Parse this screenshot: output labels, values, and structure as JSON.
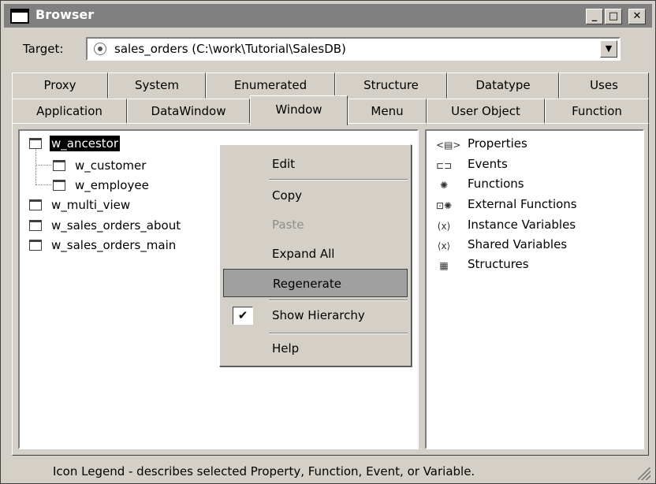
{
  "window": {
    "title": "Browser"
  },
  "target": {
    "label": "Target:",
    "value": "sales_orders (C:\\work\\Tutorial\\SalesDB)"
  },
  "tabs": {
    "row1": [
      "Proxy",
      "System",
      "Enumerated",
      "Structure",
      "Datatype",
      "Uses"
    ],
    "row2": [
      "Application",
      "DataWindow",
      "Window",
      "Menu",
      "User Object",
      "Function"
    ],
    "active": "Window"
  },
  "tree": [
    {
      "label": "w_ancestor",
      "selected": true
    },
    {
      "label": "w_customer"
    },
    {
      "label": "w_employee"
    },
    {
      "label": "w_multi_view"
    },
    {
      "label": "w_sales_orders_about"
    },
    {
      "label": "w_sales_orders_main"
    }
  ],
  "legend": [
    {
      "icon": "properties-icon",
      "label": "Properties"
    },
    {
      "icon": "events-icon",
      "label": "Events"
    },
    {
      "icon": "functions-icon",
      "label": "Functions"
    },
    {
      "icon": "external-functions-icon",
      "label": "External Functions"
    },
    {
      "icon": "instance-variables-icon",
      "label": "Instance Variables"
    },
    {
      "icon": "shared-variables-icon",
      "label": "Shared Variables"
    },
    {
      "icon": "structures-icon",
      "label": "Structures"
    }
  ],
  "context_menu": {
    "items": [
      {
        "label": "Edit"
      },
      {
        "label": "Copy"
      },
      {
        "label": "Paste",
        "disabled": true
      },
      {
        "label": "Expand All"
      },
      {
        "label": "Regenerate",
        "highlighted": true
      },
      {
        "label": "Show Hierarchy",
        "checked": true
      },
      {
        "label": "Help"
      }
    ]
  },
  "status": {
    "text": "Icon Legend - describes selected Property, Function, Event, or Variable."
  },
  "colors": {
    "title_bar": "#808080",
    "face": "#d4d0c8",
    "highlight": "#a0a0a0"
  }
}
